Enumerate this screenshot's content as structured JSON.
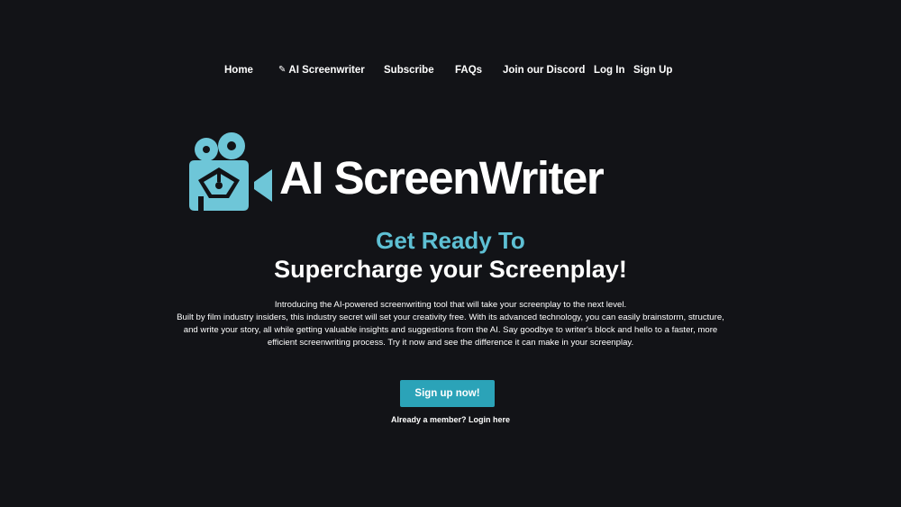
{
  "nav": {
    "items": [
      {
        "label": "Home"
      },
      {
        "label": "AI Screenwriter",
        "icon": "pencil-icon"
      },
      {
        "label": "Subscribe"
      },
      {
        "label": "FAQs"
      },
      {
        "label": "Join our Discord"
      },
      {
        "label": "Log In"
      },
      {
        "label": "Sign Up"
      }
    ]
  },
  "logo": {
    "text": "AI ScreenWriter",
    "icon": "film-camera-pen-icon",
    "color": "#6ec6d8"
  },
  "hero": {
    "headline_accent": "Get Ready To",
    "headline_main": "Supercharge your Screenplay!",
    "description_line1": "Introducing the AI-powered screenwriting tool that will take your screenplay to the next level.",
    "description_line2": "Built by film industry insiders, this industry secret will set your creativity free. With its advanced technology, you can easily brainstorm, structure, and write your story, all while getting valuable insights and suggestions from the AI. Say goodbye to writer's block and hello to a faster, more efficient screenwriting process. Try it now and see the difference it can make in your screenplay.",
    "cta_label": "Sign up now!",
    "login_prompt": "Already a member?",
    "login_link": "Login here"
  },
  "colors": {
    "background": "#121317",
    "accent": "#5ec0d4",
    "button": "#2ba3b8",
    "text": "#ffffff"
  }
}
